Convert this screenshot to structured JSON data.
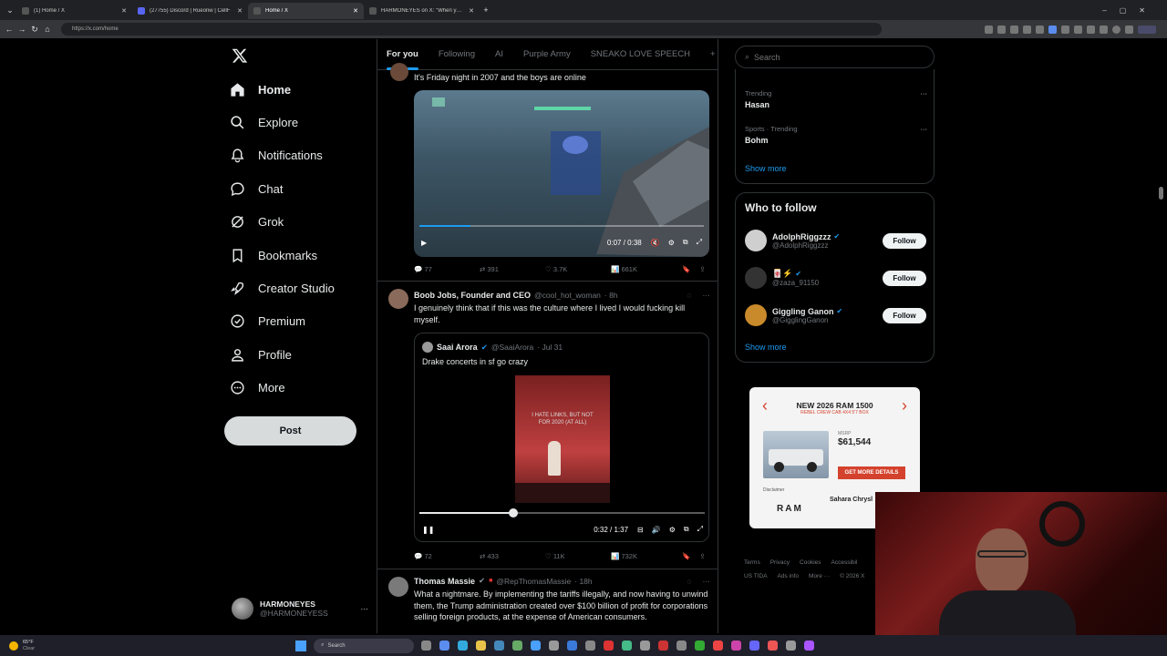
{
  "browser": {
    "tabs": [
      {
        "title": "(1) Home / X"
      },
      {
        "title": "(27755) Discord | Rueonw | CellF"
      },
      {
        "title": "Home / X"
      },
      {
        "title": "HARMONEYES on X: \"When you R"
      }
    ],
    "new_tab": "+",
    "url": "https://x.com/home"
  },
  "sidebar": {
    "items": [
      {
        "label": "Home",
        "icon": "home-icon"
      },
      {
        "label": "Explore",
        "icon": "search-icon"
      },
      {
        "label": "Notifications",
        "icon": "bell-icon"
      },
      {
        "label": "Chat",
        "icon": "chat-icon"
      },
      {
        "label": "Grok",
        "icon": "grok-icon"
      },
      {
        "label": "Bookmarks",
        "icon": "bookmark-icon"
      },
      {
        "label": "Creator Studio",
        "icon": "rocket-icon"
      },
      {
        "label": "Premium",
        "icon": "premium-icon"
      },
      {
        "label": "Profile",
        "icon": "person-icon"
      },
      {
        "label": "More",
        "icon": "more-circle-icon"
      }
    ],
    "post_label": "Post",
    "account": {
      "name": "HARMONEYES",
      "handle": "@HARMONEYESS"
    }
  },
  "feed_tabs": [
    "For you",
    "Following",
    "AI",
    "Purple Army",
    "SNEAKO LOVE SPEECH",
    "+"
  ],
  "posts": [
    {
      "text": "It's Friday night in 2007 and the boys are online",
      "video_time": "0:07 / 0:38",
      "video_progress": 0.18,
      "stats": {
        "replies": "77",
        "reposts": "391",
        "likes": "3.7K",
        "views": "661K"
      }
    },
    {
      "author": "Boob Jobs, Founder and CEO",
      "handle": "@cool_hot_woman",
      "time": "· 8h",
      "text": "I genuinely think that if this was the culture where I lived I would fucking kill myself.",
      "quote": {
        "author": "Saai Arora",
        "handle": "@SaaiArora",
        "time": "· Jul 31",
        "text": "Drake concerts in sf go crazy",
        "screen_text": "I HATE LINKS, BUT NOT FOR 2020 (AT ALL)",
        "video_time": "0:32 / 1:37",
        "video_progress": 0.33
      },
      "stats": {
        "replies": "72",
        "reposts": "433",
        "likes": "11K",
        "views": "732K"
      }
    },
    {
      "author": "Thomas Massie",
      "handle": "@RepThomasMassie",
      "time": "· 18h",
      "text": "What a nightmare. By implementing the tariffs illegally, and now having to unwind them, the Trump administration created over $100 billion of profit for corporations selling foreign products, at the expense of American consumers."
    }
  ],
  "right": {
    "search_placeholder": "Search",
    "trending": [
      {
        "context": "Trending",
        "topic": "Hasan"
      },
      {
        "context": "Sports · Trending",
        "topic": "Bohm"
      }
    ],
    "show_more": "Show more",
    "who_to_follow_title": "Who to follow",
    "follow_suggestions": [
      {
        "name": "AdolphRiggzzz",
        "handle": "@AdolphRiggzzz",
        "verified": true
      },
      {
        "name": "🀄⚡",
        "handle": "@zaza_91150",
        "verified": true
      },
      {
        "name": "Giggling Ganon",
        "handle": "@GigglingGanon",
        "verified": true
      }
    ],
    "follow_label": "Follow",
    "ad": {
      "headline": "NEW 2026 RAM 1500",
      "subline": "REBEL CREW CAB 4X4 5'7 BOX",
      "price_label": "MSRP",
      "price": "$61,544",
      "cta": "GET MORE DETAILS",
      "disclaimer": "Disclaimer",
      "dealer": "Sahara Chrysl",
      "brand": "RAM"
    },
    "footer": [
      "Terms",
      "Privacy",
      "Cookies",
      "Accessibil",
      "US TIDA",
      "Ads info",
      "More ···",
      "© 2026 X"
    ]
  },
  "taskbar": {
    "weather_temp": "65°F",
    "weather_desc": "Clear",
    "search_label": "Search"
  },
  "colors": {
    "accent": "#1d9bf0",
    "background": "#000000",
    "border": "#2f3336",
    "ad_red": "#d4422d"
  }
}
